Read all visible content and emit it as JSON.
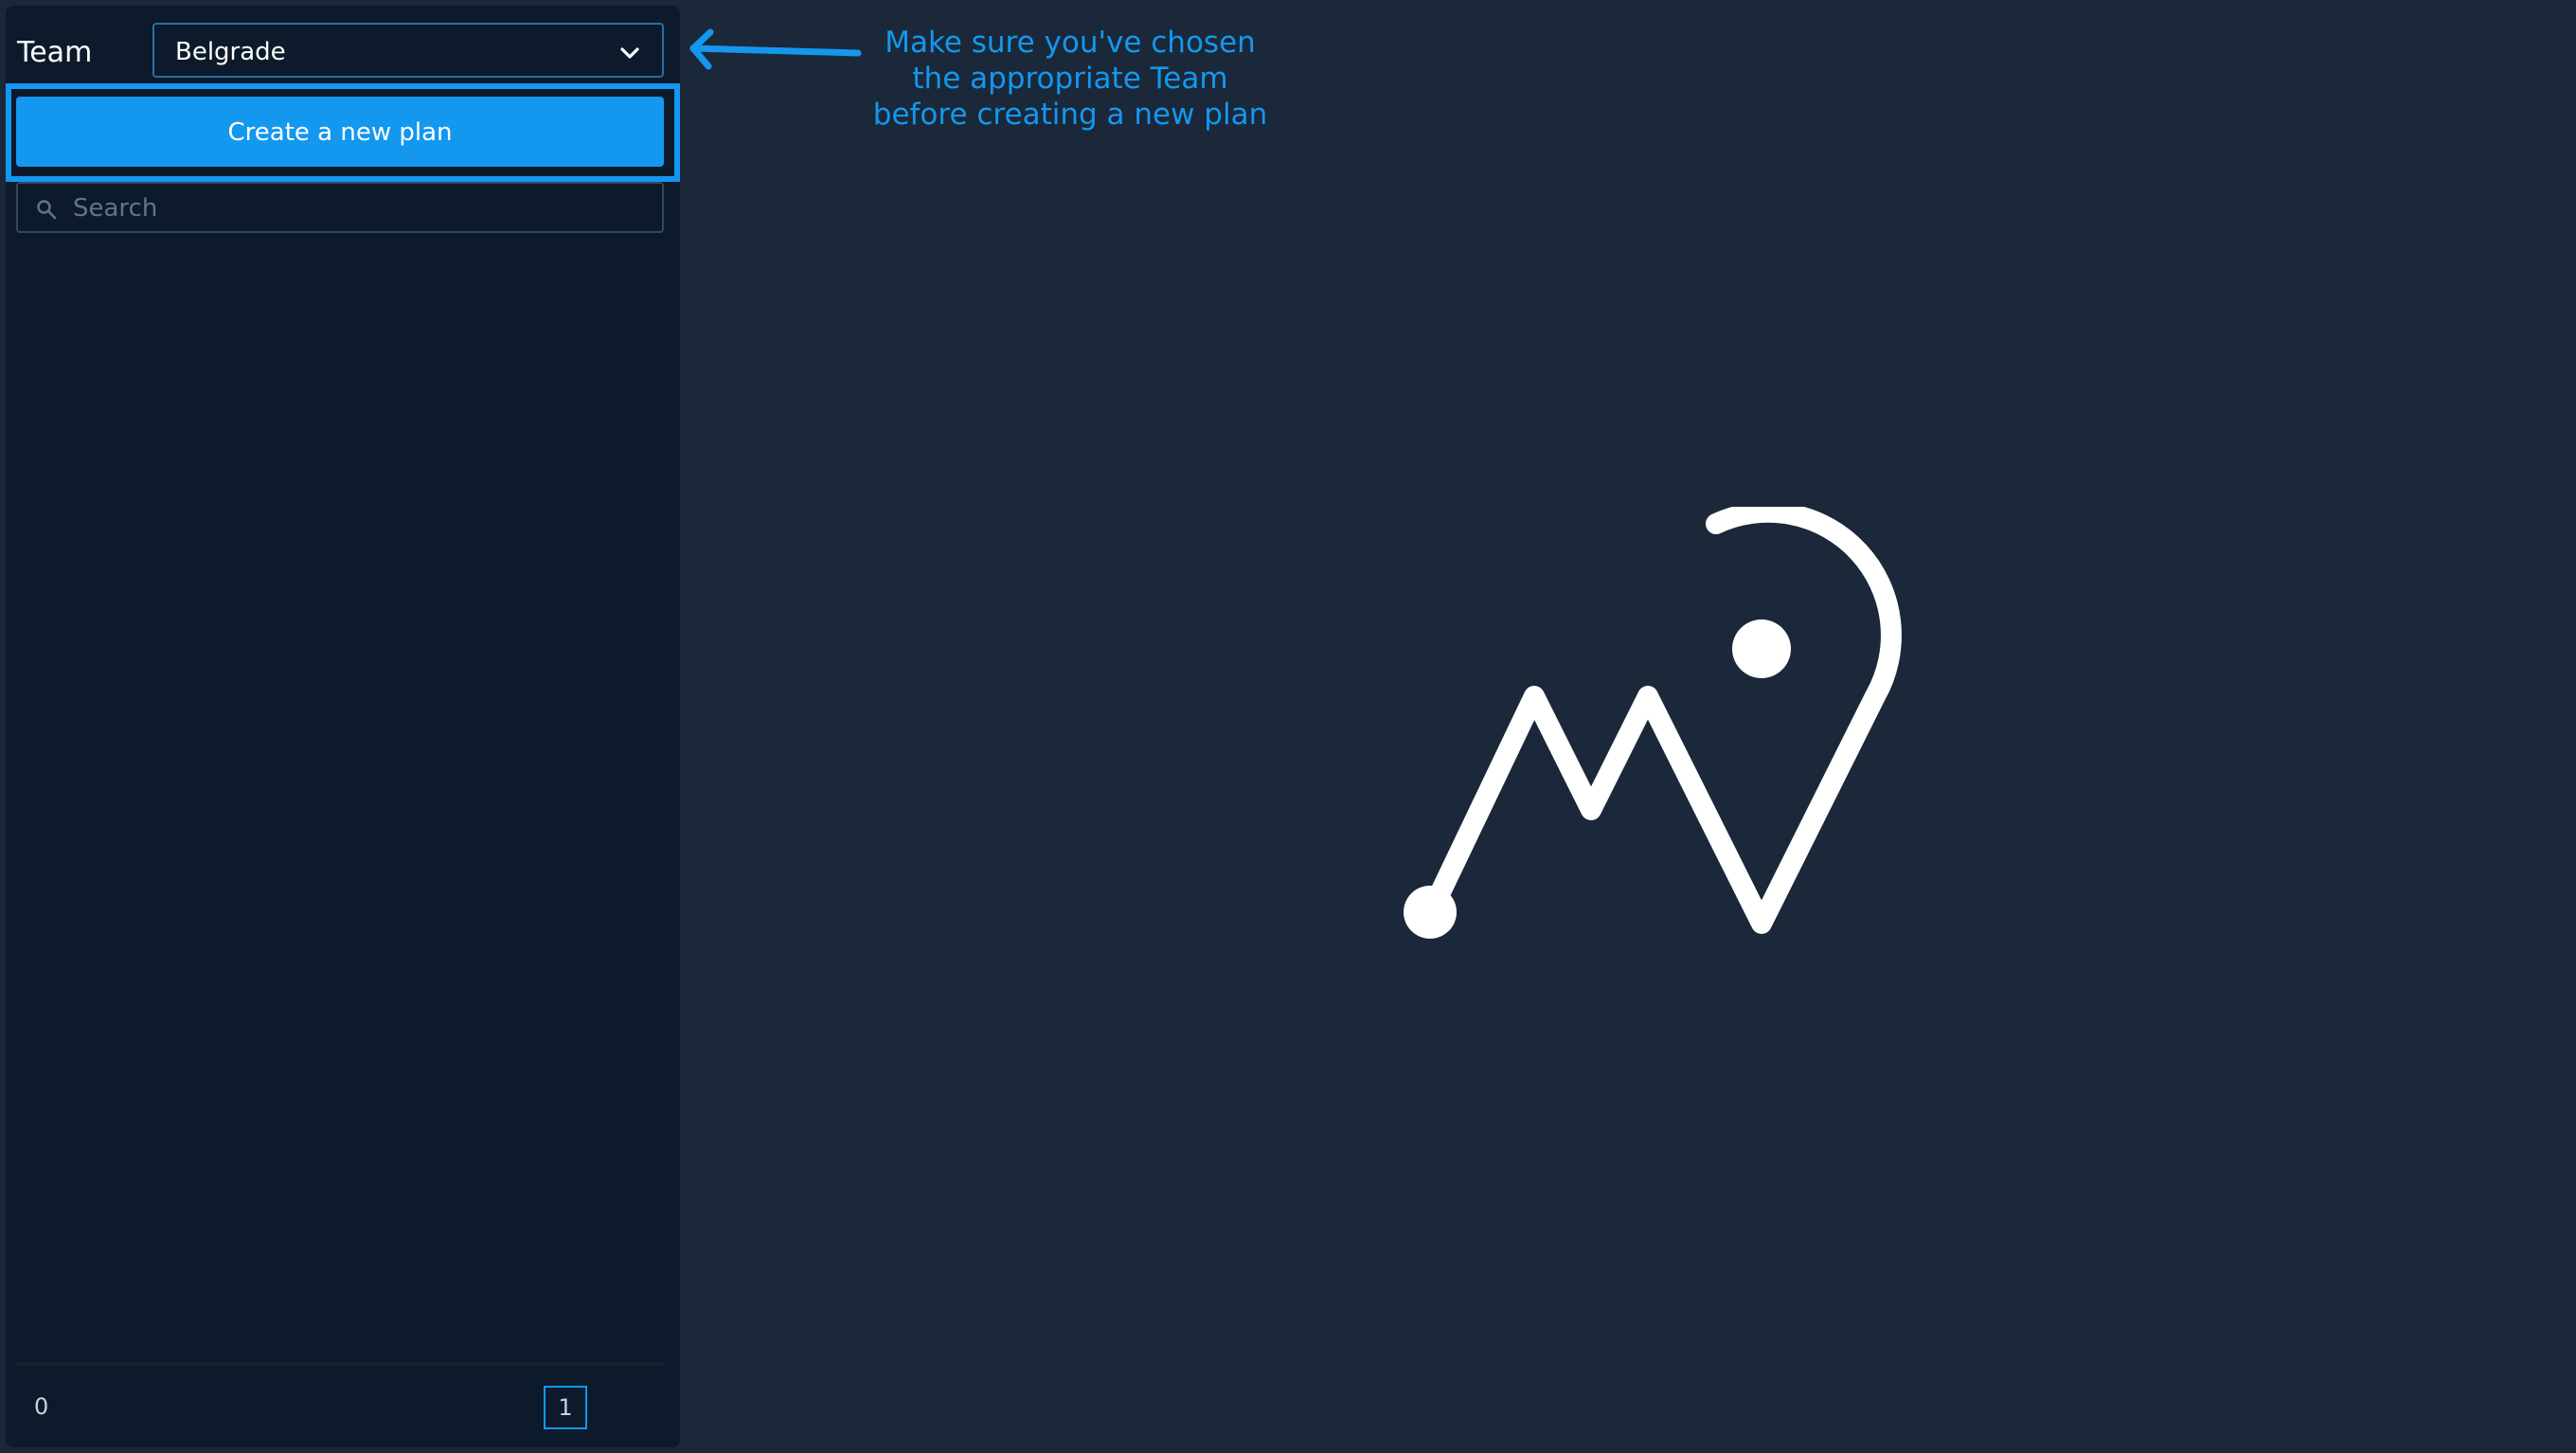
{
  "sidebar": {
    "team_label": "Team",
    "team_value": "Belgrade",
    "create_button_label": "Create a new plan",
    "search_placeholder": "Search",
    "footer_count": "0",
    "page_number": "1"
  },
  "annotation": {
    "line1": "Make sure you've chosen",
    "line2": "the appropriate Team",
    "line3": "before creating a new plan"
  },
  "icons": {
    "team_dropdown": "chevron-down-icon",
    "search": "search-icon",
    "annotation": "arrow-left-icon",
    "logo": "app-logo"
  },
  "colors": {
    "background": "#1a2839",
    "sidebar": "#0c1a2c",
    "accent": "#1497ee",
    "text": "#ffffff"
  }
}
